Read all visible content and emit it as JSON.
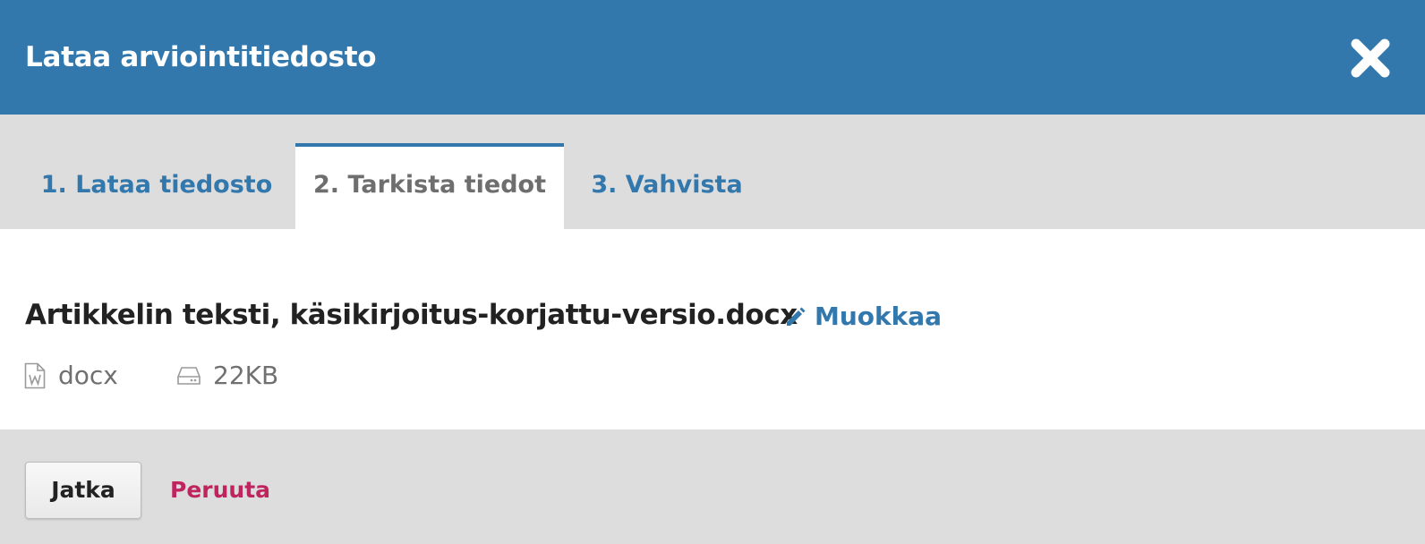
{
  "modal": {
    "title": "Lataa arviointitiedosto",
    "close_icon": "close-icon"
  },
  "tabs": [
    {
      "label": "1. Lataa tiedosto",
      "state": "inactive"
    },
    {
      "label": "2. Tarkista tiedot",
      "state": "active"
    },
    {
      "label": "3. Vahvista",
      "state": "inactive"
    }
  ],
  "file": {
    "title": "Artikkelin teksti, käsikirjoitus-korjattu-versio.docx",
    "edit_label": "Muokkaa",
    "edit_icon": "pencil-icon",
    "type_icon": "word-document-icon",
    "type": "docx",
    "size_icon": "hard-drive-icon",
    "size": "22KB"
  },
  "footer": {
    "continue_label": "Jatka",
    "cancel_label": "Peruuta"
  },
  "colors": {
    "primary": "#3278ad",
    "cancel": "#c0245f",
    "panel_bg": "#dddddd",
    "content_bg": "#ffffff"
  }
}
